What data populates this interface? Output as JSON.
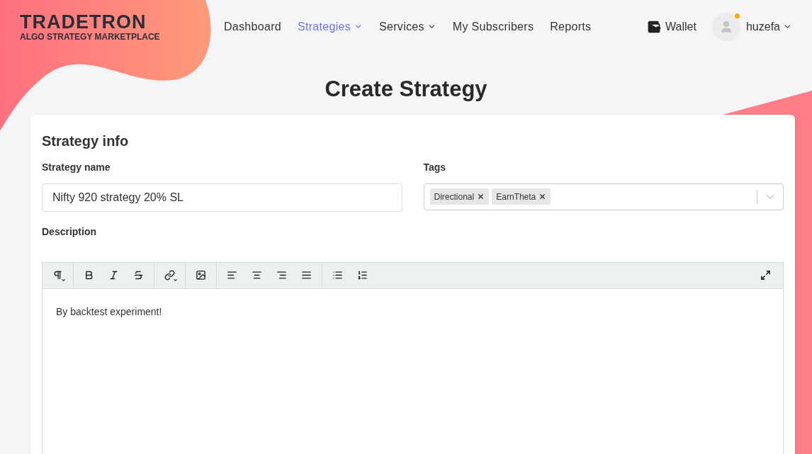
{
  "logo": {
    "name": "TRADETRON",
    "tagline": "ALGO STRATEGY MARKETPLACE"
  },
  "nav": [
    {
      "label": "Dashboard",
      "selected": false,
      "dropdown": false
    },
    {
      "label": "Strategies",
      "selected": true,
      "dropdown": true
    },
    {
      "label": "Services",
      "selected": false,
      "dropdown": true
    },
    {
      "label": "My Subscribers",
      "selected": false,
      "dropdown": false
    },
    {
      "label": "Reports",
      "selected": false,
      "dropdown": false
    }
  ],
  "wallet": {
    "label": "Wallet"
  },
  "user": {
    "name": "huzefa",
    "online": true
  },
  "page_title": "Create Strategy",
  "card": {
    "title": "Strategy info",
    "strategy_name": {
      "label": "Strategy name",
      "value": "Nifty 920 strategy 20% SL"
    },
    "tags": {
      "label": "Tags",
      "items": [
        "Directional",
        "EarnTheta"
      ]
    },
    "description": {
      "label": "Description",
      "value": "By backtest experiment!"
    }
  }
}
